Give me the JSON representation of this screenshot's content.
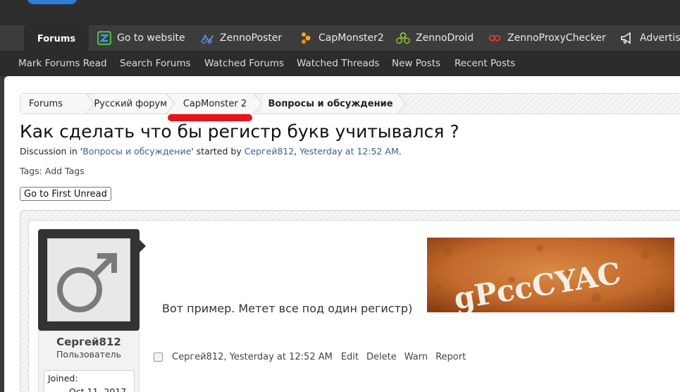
{
  "nav": {
    "active_tab": "Forums",
    "tabs": [
      {
        "label": "Go to website",
        "icon": "zennolab-logo-icon"
      },
      {
        "label": "ZennoPoster",
        "icon": "zennoposter-icon"
      },
      {
        "label": "CapMonster2",
        "icon": "capmonster-icon"
      },
      {
        "label": "ZennoDroid",
        "icon": "zennodroid-icon"
      },
      {
        "label": "ZennoProxyChecker",
        "icon": "proxychecker-icon"
      },
      {
        "label": "Advertisin",
        "icon": "megaphone-icon"
      }
    ],
    "accent": "#2f7fd6"
  },
  "subnav": [
    "Mark Forums Read",
    "Search Forums",
    "Watched Forums",
    "Watched Threads",
    "New Posts",
    "Recent Posts"
  ],
  "breadcrumb": [
    "Forums",
    "Русский форум",
    "CapMonster 2",
    "Вопросы и обсуждение"
  ],
  "thread": {
    "title": "Как сделать что бы регистр букв учитывался ?",
    "meta_prefix": "Discussion in '",
    "forum_link": "Вопросы и обсуждение",
    "meta_middle": "' started by ",
    "author_link": "Сергей812",
    "meta_sep": ", ",
    "date_link": "Yesterday at 12:52 AM",
    "meta_end": ".",
    "tags_label": "Tags:",
    "tags_link": "Add Tags",
    "first_unread_button": "Go to First Unread"
  },
  "post": {
    "username": "Сергей812",
    "user_title": "Пользователь",
    "joined_label": "Joined:",
    "joined_value": "Oct 11, 2017",
    "message": "Вот пример. Метет все под один регистр)",
    "captcha_text": "gPccCYAC",
    "footer_author": "Сергей812",
    "footer_date": "Yesterday at 12:52 AM",
    "actions": [
      "Edit",
      "Delete",
      "Warn",
      "Report"
    ],
    "highlight_color": "#e8131a"
  }
}
